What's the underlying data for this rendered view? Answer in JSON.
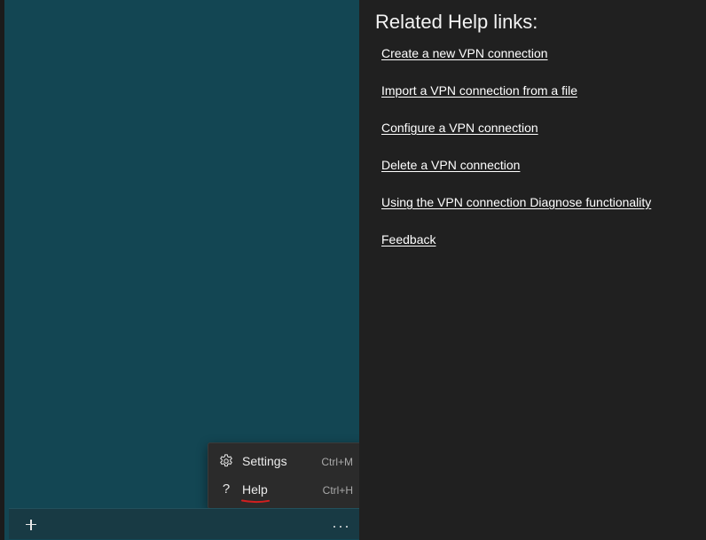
{
  "help_panel": {
    "title": "Related Help links:",
    "links": [
      {
        "label": "Create a new VPN connection"
      },
      {
        "label": "Import a VPN connection from a file"
      },
      {
        "label": "Configure a VPN connection"
      },
      {
        "label": "Delete a VPN connection"
      },
      {
        "label": "Using the VPN connection Diagnose functionality"
      },
      {
        "label": "Feedback"
      }
    ]
  },
  "menu": {
    "items": [
      {
        "label": "Settings",
        "shortcut": "Ctrl+M",
        "icon": "gear-icon"
      },
      {
        "label": "Help",
        "shortcut": "Ctrl+H",
        "icon": "question-mark-icon"
      }
    ],
    "help_icon_glyph": "?"
  },
  "bottom_bar": {
    "add_icon": "plus-icon",
    "more_icon": "ellipsis-icon"
  },
  "colors": {
    "left_pane_bg": "#134653",
    "right_pane_bg": "#202020",
    "annotation_red": "#d21f1f"
  }
}
